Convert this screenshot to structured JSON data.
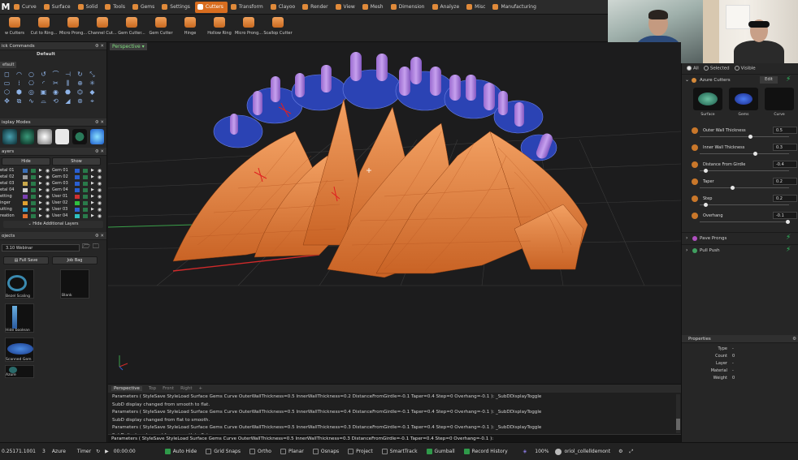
{
  "app": {
    "logo": "M"
  },
  "tabs": [
    {
      "label": "Curve"
    },
    {
      "label": "Surface"
    },
    {
      "label": "Solid"
    },
    {
      "label": "Tools"
    },
    {
      "label": "Gems"
    },
    {
      "label": "Settings"
    },
    {
      "label": "Cutters",
      "active": true
    },
    {
      "label": "Transform"
    },
    {
      "label": "Clayoo"
    },
    {
      "label": "Render"
    },
    {
      "label": "View"
    },
    {
      "label": "Mesh"
    },
    {
      "label": "Dimension"
    },
    {
      "label": "Analyze"
    },
    {
      "label": "Misc"
    },
    {
      "label": "Manufacturing"
    }
  ],
  "tools": [
    {
      "label": "w Cutters"
    },
    {
      "label": "Cut to Ring..."
    },
    {
      "label": "Micro Prong..."
    },
    {
      "label": "Channel Cut..."
    },
    {
      "label": "Gem Cutter..."
    },
    {
      "label": "Gem Cutter"
    },
    {
      "label": "Hinge"
    },
    {
      "label": "Hollow Ring"
    },
    {
      "label": "Micro Prong..."
    },
    {
      "label": "Scallop Cutter"
    }
  ],
  "left": {
    "quick_commands": {
      "title": "ick Commands",
      "preset": "Default",
      "default_btn": "efault"
    },
    "display_modes": {
      "title": "isplay Modes"
    },
    "layers": {
      "title": "ayers",
      "hide_label": "Hide",
      "show_label": "Show",
      "left_col": [
        "etal 01",
        "etal 02",
        "etal 03",
        "etal 04",
        "etting",
        "inger",
        "utting",
        "reation"
      ],
      "right_col": [
        "Gem 01",
        "Gem 02",
        "Gem 03",
        "Gem 04",
        "User 01",
        "User 02",
        "User 03",
        "User 04"
      ],
      "left_colors": [
        "#3b6fb6",
        "#a0a0a0",
        "#c9a84a",
        "#d0d0d0",
        "#7a3fb0",
        "#e0a030",
        "#30a0d0",
        "#e07030"
      ],
      "right_colors": [
        "#2a5fd0",
        "#2a5fd0",
        "#2a5fd0",
        "#2a5fd0",
        "#d03030",
        "#30c040",
        "#3060d0",
        "#30c0c0"
      ],
      "hide_additional": "Hide Additional Layers"
    },
    "projects": {
      "title": "ojects",
      "current": "3.10 Webinar",
      "full_save": "Full Save",
      "job_bag": "Job Bag",
      "items": [
        {
          "label": "Bezel Scaling"
        },
        {
          "label": "Blank"
        },
        {
          "label": "Hide boolean"
        },
        {
          "label": "Scanned Gem"
        },
        {
          "label": "Azure"
        }
      ]
    }
  },
  "viewport": {
    "label": "Perspective"
  },
  "command": {
    "tabs": [
      "Perspective",
      "Top",
      "Front",
      "Right",
      "+"
    ],
    "lines": [
      "Parameters ( StyleSave  StyleLoad  Surface  Gems  Curve  OuterWallThickness=0.5  InnerWallThickness=0.2  DistanceFromGirdle=-0.1  Taper=0.4  Step=0  Overhang=-0.1 ): _SubDDisplayToggle",
      "SubD display changed from smooth to flat.",
      "Parameters ( StyleSave  StyleLoad  Surface  Gems  Curve  OuterWallThickness=0.5  InnerWallThickness=0.4  DistanceFromGirdle=-0.1  Taper=0.4  Step=0  Overhang=-0.1 ): _SubDDisplayToggle",
      "SubD display changed from flat to smooth.",
      "Parameters ( StyleSave  StyleLoad  Surface  Gems  Curve  OuterWallThickness=0.5  InnerWallThickness=0.3  DistanceFromGirdle=-0.1  Taper=0.4  Step=0  Overhang=-0.1 ): _SubDDisplayToggle",
      "SubD display changed from smooth to flat."
    ],
    "input": "Parameters ( StyleSave  StyleLoad  Surface  Gems  Curve  OuterWallThickness=0.5  InnerWallThickness=0.3  DistanceFromGirdle=-0.1  Taper=0.4  Step=0  Overhang=-0.1 ):"
  },
  "right": {
    "filters": [
      "All",
      "Selected",
      "Visible"
    ],
    "section": "Azure Cutters",
    "edit": "Edit",
    "tiles": [
      "Surface",
      "Gems",
      "Curve"
    ],
    "params": [
      {
        "label": "Outer Wall Thickness",
        "value": "0.5",
        "level": 0.56
      },
      {
        "label": "Inner Wall Thickness",
        "value": "0.3",
        "level": 0.62
      },
      {
        "label": "Distance From Girdle",
        "value": "-0.4",
        "level": 0.06
      },
      {
        "label": "Taper",
        "value": "0.2",
        "level": 0.36
      },
      {
        "label": "Step",
        "value": "0.2",
        "level": 0.06
      },
      {
        "label": "Overhang",
        "value": "-0.1",
        "level": 0.98
      }
    ],
    "sub_sections": [
      "Pave Prongs",
      "Pull Push"
    ],
    "properties": {
      "title": "Properties",
      "rows": [
        {
          "k": "Type",
          "v": "-"
        },
        {
          "k": "Count",
          "v": "0"
        },
        {
          "k": "Layer",
          "v": "-"
        },
        {
          "k": "Material",
          "v": "-"
        },
        {
          "k": "Weight",
          "v": "0"
        }
      ]
    }
  },
  "status": {
    "coords": "0.25171.1001",
    "num": "3",
    "layer": "Azure",
    "timer_label": "Timer",
    "time": "00:00:00",
    "toggles": [
      {
        "label": "Auto Hide",
        "on": true
      },
      {
        "label": "Grid Snaps",
        "on": false
      },
      {
        "label": "Ortho",
        "on": false
      },
      {
        "label": "Planar",
        "on": false
      },
      {
        "label": "Osnaps",
        "on": false
      },
      {
        "label": "Project",
        "on": false
      },
      {
        "label": "SmartTrack",
        "on": false
      },
      {
        "label": "Gumball",
        "on": true
      },
      {
        "label": "Record History",
        "on": true
      }
    ],
    "zoom": "100%",
    "user": "oriol_collelldemont"
  }
}
